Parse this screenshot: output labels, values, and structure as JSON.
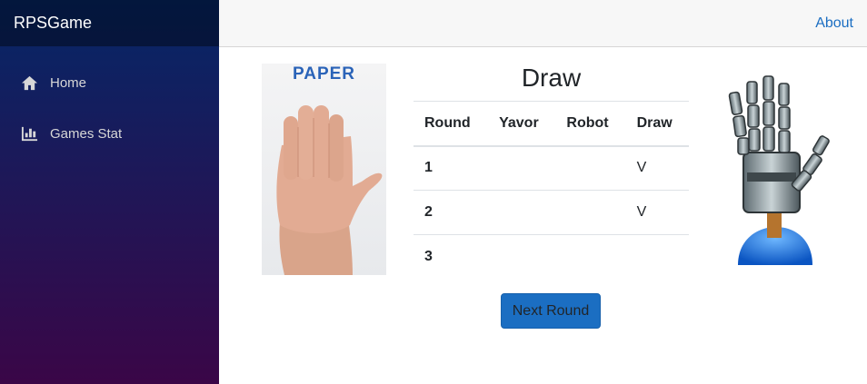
{
  "brand": "RPSGame",
  "nav": [
    {
      "label": "Home",
      "icon": "home-icon"
    },
    {
      "label": "Games Stat",
      "icon": "bar-chart-icon"
    }
  ],
  "top_row": {
    "about": "About"
  },
  "player_choice": {
    "label": "PAPER"
  },
  "result": "Draw",
  "table": {
    "headers": [
      "Round",
      "Yavor",
      "Robot",
      "Draw"
    ],
    "rows": [
      {
        "round": "1",
        "yavor": "",
        "robot": "",
        "draw": "V"
      },
      {
        "round": "2",
        "yavor": "",
        "robot": "",
        "draw": "V"
      },
      {
        "round": "3",
        "yavor": "",
        "robot": "",
        "draw": ""
      }
    ]
  },
  "next_button": "Next Round",
  "colors": {
    "accent": "#1b6ec2",
    "sidebar_top": "#052767",
    "sidebar_bottom": "#3a0647"
  }
}
